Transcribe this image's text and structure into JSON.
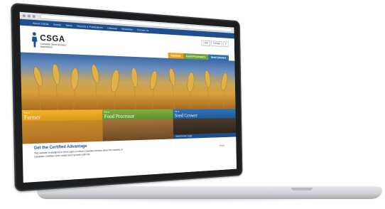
{
  "nav": {
    "items": [
      "About CSGA",
      "Seeds",
      "News",
      "Reports & Publications",
      "Calendar",
      "Newsletter",
      "Contact Us"
    ]
  },
  "logo": {
    "acronym": "CSGA",
    "full_name": "Canadian Seed Growers' Association"
  },
  "header": {
    "login_label": "Login",
    "francais_label": "Français"
  },
  "tabs": [
    {
      "label": "Farmers"
    },
    {
      "label": "Food Processors"
    },
    {
      "label": "Seed Growers"
    }
  ],
  "cards": [
    {
      "prefix": "For a",
      "title": "Farmer"
    },
    {
      "prefix": "For a",
      "title": "Food Processor"
    },
    {
      "prefix": "For a",
      "title": "Seed Grower",
      "login_link": "Seed Grower Login"
    }
  ],
  "body": {
    "title": "Get the Certified Advantage",
    "text": "This website is designed in three parts to inform Canadian farmers about the benefits of Canadian Certified seed, assist seed growers with the",
    "side_label": "News"
  },
  "colors": {
    "nav_blue": "#1f4e8c",
    "farmers_orange": "#e9a21b",
    "processors_green": "#6ea33b",
    "growers_blue": "#2d71b4"
  }
}
